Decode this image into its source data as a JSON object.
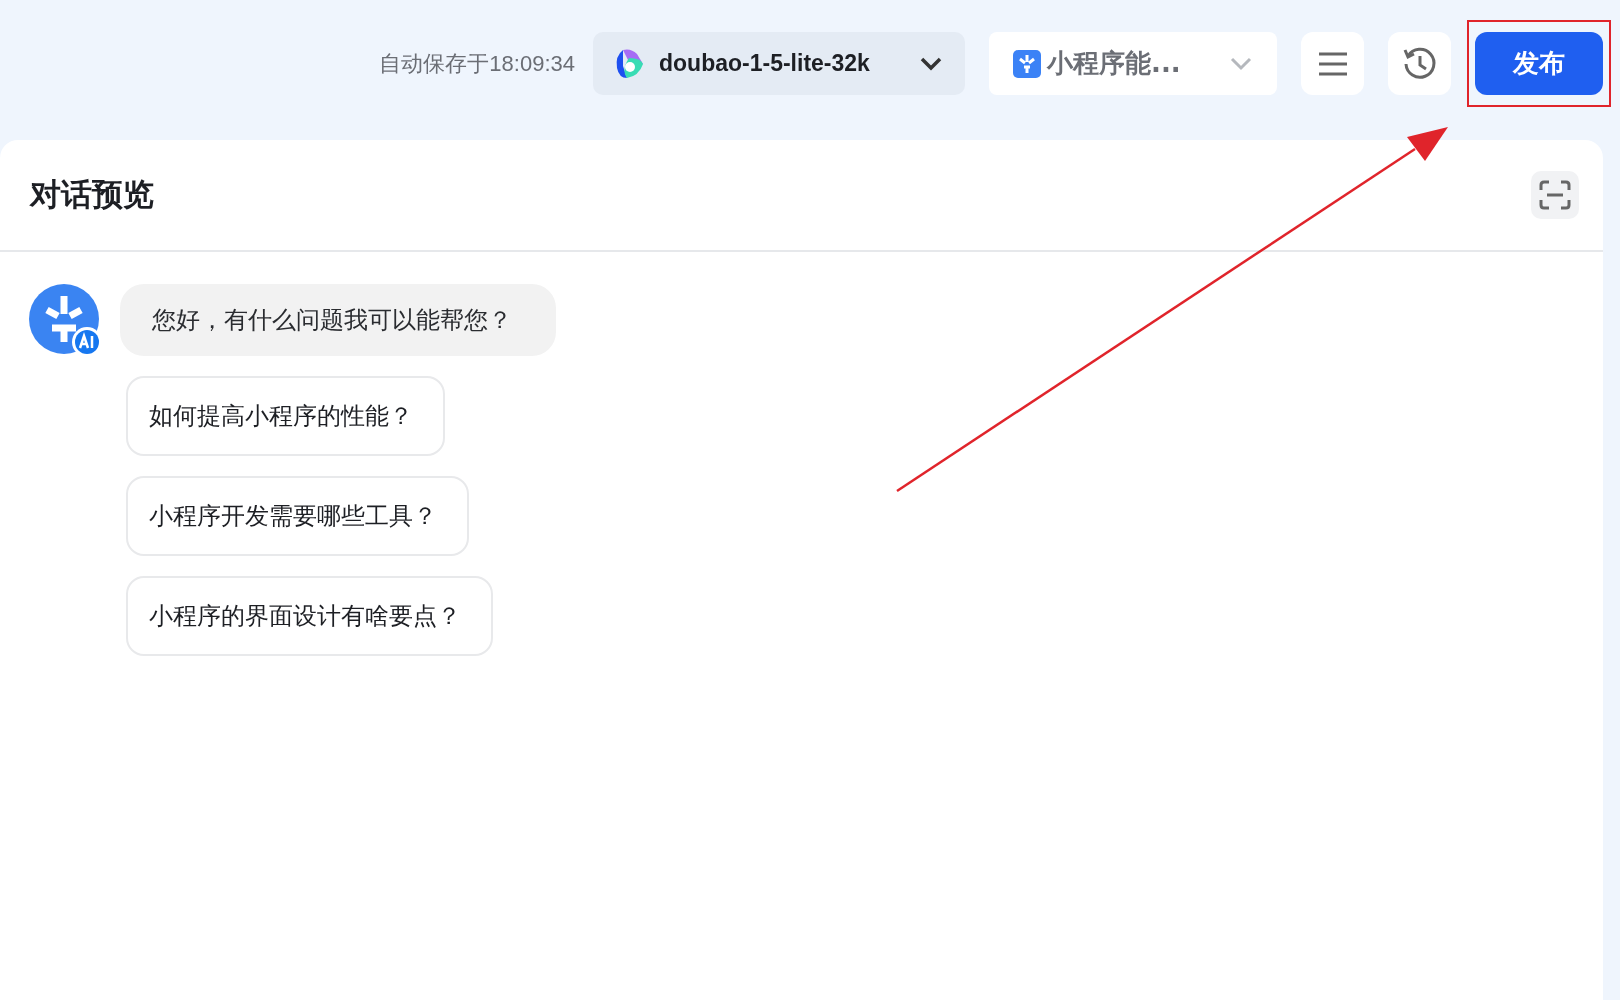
{
  "toolbar": {
    "autosave": "自动保存于18:09:34",
    "model_select": {
      "value": "doubao-1-5-lite-32k"
    },
    "skill_select": {
      "value": "小程序能..."
    },
    "publish_button": {
      "label": "发布",
      "highlighted": true
    }
  },
  "preview": {
    "title": "对话预览",
    "messages": [
      {
        "kind": "bot",
        "text": "您好，有什么问题我可以能帮您？"
      }
    ],
    "suggestions": [
      "如何提高小程序的性能？",
      "小程序开发需要哪些工具？",
      "小程序的界面设计有啥要点？"
    ]
  }
}
